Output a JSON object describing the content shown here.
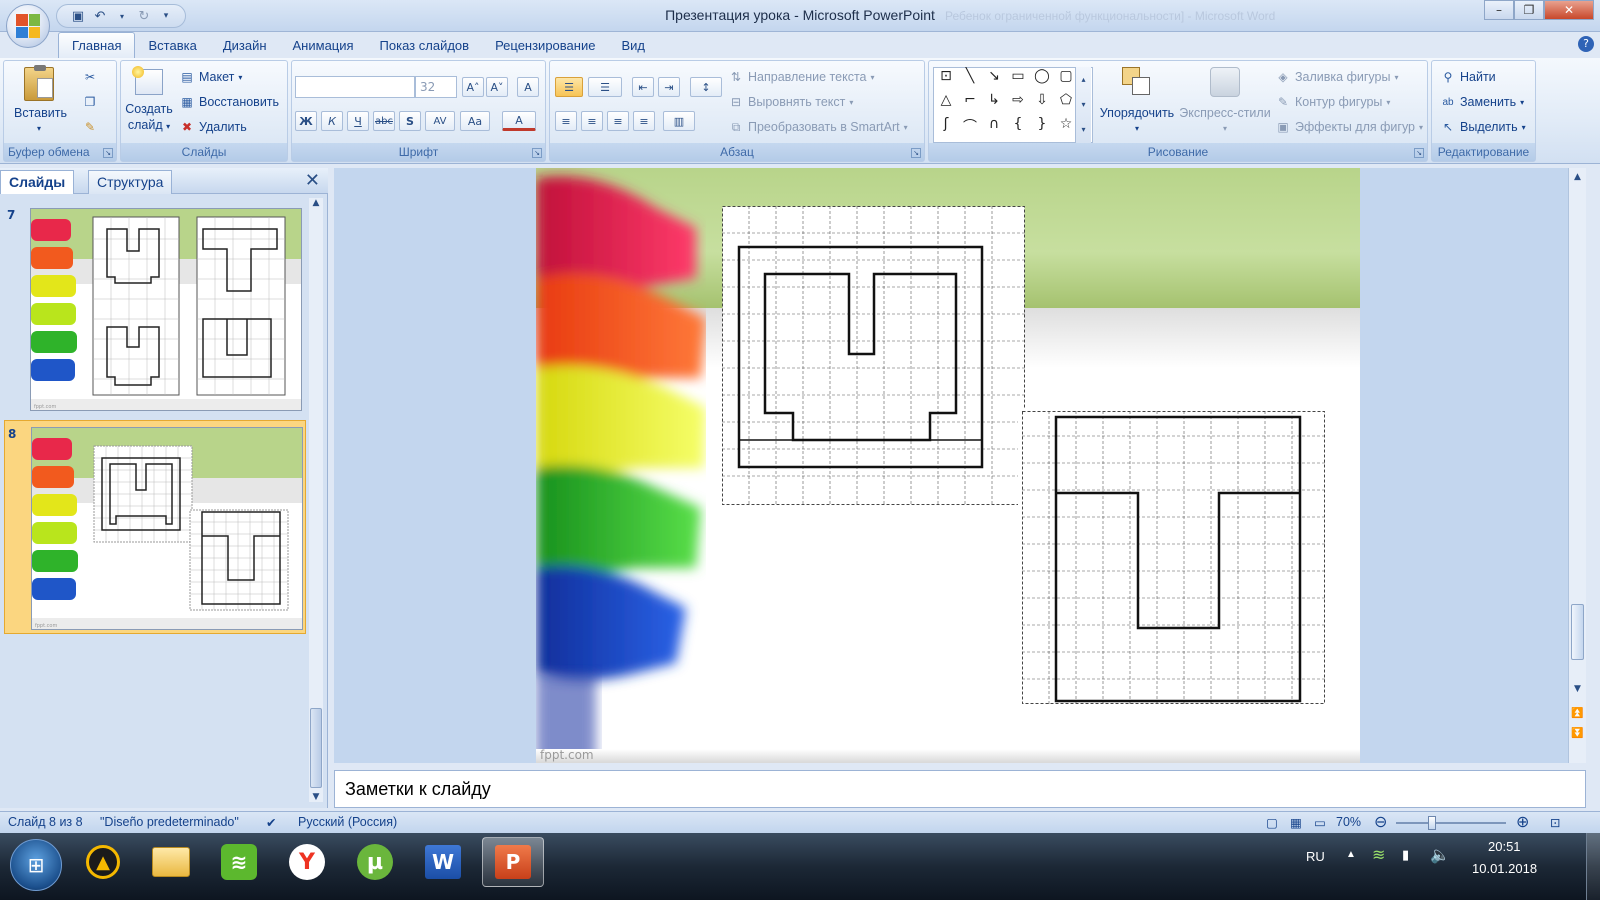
{
  "window": {
    "title": "Презентация урока - Microsoft PowerPoint",
    "ghost_title": "Ребенок ограниченной функциональности] - Microsoft Word"
  },
  "tabs": [
    "Главная",
    "Вставка",
    "Дизайн",
    "Анимация",
    "Показ слайдов",
    "Рецензирование",
    "Вид"
  ],
  "ribbon": {
    "clipboard": {
      "paste": "Вставить",
      "label": "Буфер обмена"
    },
    "slides": {
      "create": "Создать",
      "create2": "слайд",
      "layout": "Макет",
      "reset": "Восстановить",
      "delete": "Удалить",
      "label": "Слайды"
    },
    "font": {
      "size": "32",
      "label": "Шрифт",
      "bold": "Ж",
      "italic": "К",
      "underline": "Ч",
      "strike": "abc",
      "shadow": "S",
      "spacing": "AV",
      "case": "Aa",
      "color": "A",
      "grow": "A",
      "shrink": "A",
      "clear": "A"
    },
    "paragraph": {
      "text_direction": "Направление текста",
      "align_text": "Выровнять текст",
      "smartart": "Преобразовать в SmartArt",
      "label": "Абзац"
    },
    "drawing": {
      "arrange": "Упорядочить",
      "quick_styles": "Экспресс-стили",
      "fill": "Заливка фигуры",
      "outline": "Контур фигуры",
      "effects": "Эффекты для фигур",
      "label": "Рисование"
    },
    "editing": {
      "find": "Найти",
      "replace": "Заменить",
      "select": "Выделить",
      "label": "Редактирование"
    }
  },
  "slide_pane": {
    "tab_slides": "Слайды",
    "tab_outline": "Структура",
    "thumbs": [
      {
        "num": "7",
        "footer": "fppt.com"
      },
      {
        "num": "8",
        "footer": "fppt.com"
      }
    ]
  },
  "slide": {
    "footer": "fppt.com"
  },
  "notes": {
    "placeholder": "Заметки к слайду"
  },
  "status": {
    "slide_of": "Слайд 8 из 8",
    "theme": "\"Diseño predeterminado\"",
    "language": "Русский (Россия)",
    "zoom": "70%"
  },
  "taskbar": {
    "lang": "RU",
    "time": "20:51",
    "date": "10.01.2018"
  },
  "colors": {
    "accent": "#15428b",
    "ribbon_bg": "#dfe8f5",
    "selected_thumb": "#fbd680"
  }
}
